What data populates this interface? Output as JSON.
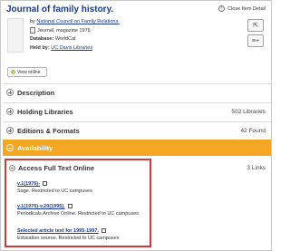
{
  "header": {
    "title": "Journal of family history.",
    "close_label": "Close Item Detail"
  },
  "record": {
    "by_prefix": "by",
    "author": "National Council on Family Relations.",
    "format": "Journal, magazine 1976",
    "database_label": "Database:",
    "database_value": "WorldCat",
    "held_label": "Held by:",
    "held_value": "UC Davis Libraries"
  },
  "controls": {
    "share_icon": "share-icon",
    "add_list_icon": "add-to-list-icon"
  },
  "view_online": {
    "label": "View online"
  },
  "sections": {
    "description": {
      "label": "Description"
    },
    "holding": {
      "label": "Holding Libraries",
      "count": "502 Libraries"
    },
    "editions": {
      "label": "Editions & Formats",
      "count": "42 Found"
    },
    "availability": {
      "label": "Availability"
    },
    "access": {
      "label": "Access Full Text Online",
      "count": "3 Links"
    }
  },
  "links": [
    {
      "title": "v.1(1976)-",
      "desc": "Sage. Restricted to UC campuses"
    },
    {
      "title": "v.1(1976)-v.20(1995).",
      "desc": "Periodicals Archive Online. Restricted to UC campuses"
    },
    {
      "title": "Selected article text for 1995-1997.",
      "desc": "Education source. Restricted to UC campuses"
    }
  ],
  "colors": {
    "link": "#1a3a8c",
    "availability_bar": "#f5a623",
    "highlight_border": "#d23a3a"
  }
}
